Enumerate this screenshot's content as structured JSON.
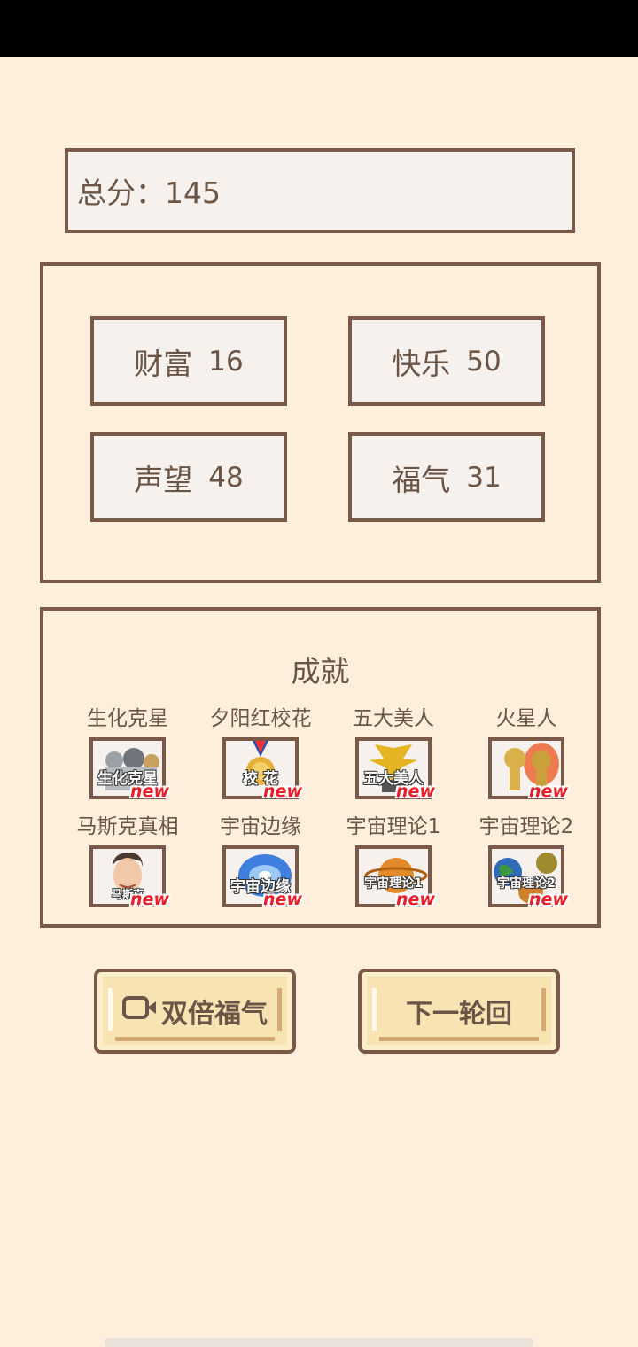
{
  "total": {
    "label": "总分：",
    "value": "145"
  },
  "stats": [
    {
      "name": "财富",
      "value": "16"
    },
    {
      "name": "快乐",
      "value": "50"
    },
    {
      "name": "声望",
      "value": "48"
    },
    {
      "name": "福气",
      "value": "31"
    }
  ],
  "achievements": {
    "title": "成就",
    "new_badge": "new",
    "items": [
      {
        "label": "生化克星",
        "icon_text": "生化克星",
        "icon": "biohazard-icon"
      },
      {
        "label": "夕阳红校花",
        "icon_text": "校 花",
        "icon": "medal-icon"
      },
      {
        "label": "五大美人",
        "icon_text": "五大美人",
        "icon": "phoenix-icon"
      },
      {
        "label": "火星人",
        "icon_text": "",
        "icon": "martian-icon"
      },
      {
        "label": "马斯克真相",
        "icon_text": "马斯克",
        "icon": "portrait-icon"
      },
      {
        "label": "宇宙边缘",
        "icon_text": "宇宙边缘",
        "icon": "galaxy-icon"
      },
      {
        "label": "宇宙理论1",
        "icon_text": "宇宙理论1",
        "icon": "saturn-icon"
      },
      {
        "label": "宇宙理论2",
        "icon_text": "宇宙理论2",
        "icon": "planets-icon"
      }
    ]
  },
  "buttons": {
    "double_luck": "双倍福气",
    "next_round": "下一轮回"
  },
  "colors": {
    "background": "#fdefdc",
    "border": "#7a5949",
    "box_fill": "#f6f1ec",
    "button_fill": "#f8e4b3",
    "new_badge": "#e8202a"
  }
}
